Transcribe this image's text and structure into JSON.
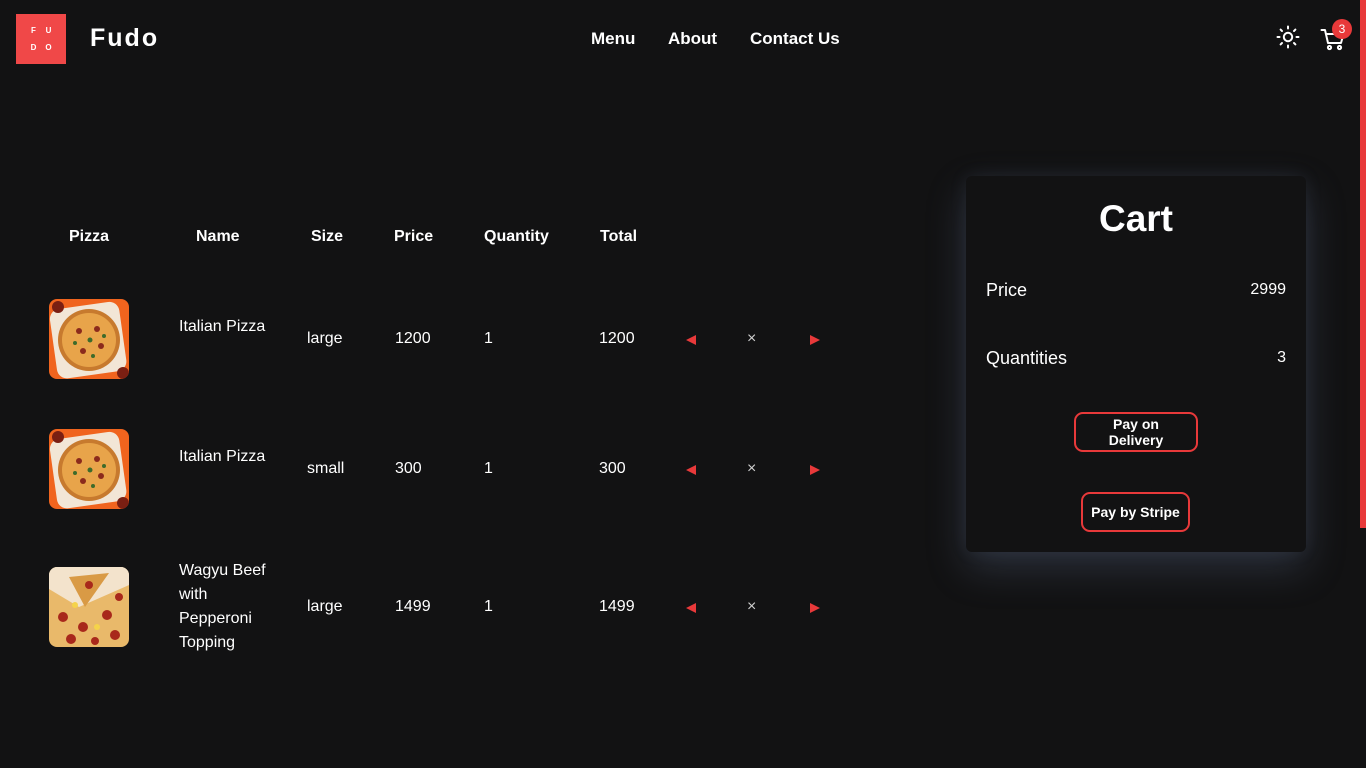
{
  "header": {
    "logo_letters": [
      "F",
      "U",
      "D",
      "O"
    ],
    "brand": "Fudo",
    "nav": [
      {
        "label": "Menu"
      },
      {
        "label": "About"
      },
      {
        "label": "Contact Us"
      }
    ],
    "theme_icon": "sun-icon",
    "cart_icon": "cart-icon",
    "cart_count": "3"
  },
  "table": {
    "headers": [
      "Pizza",
      "Name",
      "Size",
      "Price",
      "Quantity",
      "Total"
    ],
    "rows": [
      {
        "image": "italian-pizza-image",
        "name": "Italian Pizza",
        "size": "large",
        "price": "1200",
        "quantity": "1",
        "total": "1200"
      },
      {
        "image": "italian-pizza-image",
        "name": "Italian Pizza",
        "size": "small",
        "price": "300",
        "quantity": "1",
        "total": "300"
      },
      {
        "image": "wagyu-pizza-image",
        "name": "Wagyu Beef with Pepperoni Topping",
        "size": "large",
        "price": "1499",
        "quantity": "1",
        "total": "1499"
      }
    ],
    "controls": {
      "decrease_icon": "triangle-left-icon",
      "remove_symbol": "×",
      "increase_icon": "triangle-right-icon"
    }
  },
  "cart": {
    "title": "Cart",
    "price_label": "Price",
    "price_value": "2999",
    "quantities_label": "Quantities",
    "quantities_value": "3",
    "pay_delivery_label": "Pay on Delivery",
    "pay_stripe_label": "Pay by Stripe"
  },
  "colors": {
    "background": "#121213",
    "accent": "#e8393a",
    "logo": "#f04848",
    "text": "#ffffff"
  }
}
